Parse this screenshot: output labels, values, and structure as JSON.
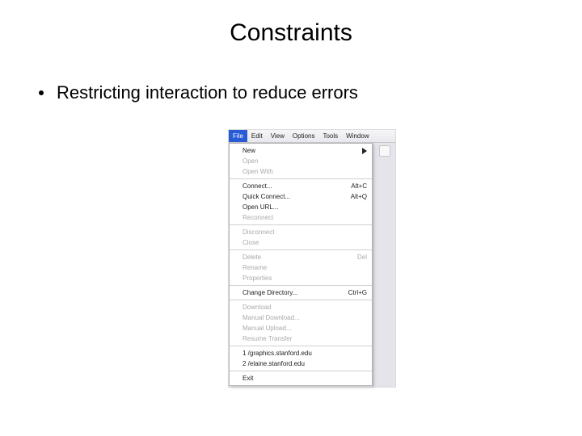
{
  "title": "Constraints",
  "bullet": "Restricting interaction to reduce errors",
  "menubar": {
    "items": [
      {
        "label": "File",
        "active": true
      },
      {
        "label": "Edit"
      },
      {
        "label": "View"
      },
      {
        "label": "Options"
      },
      {
        "label": "Tools"
      },
      {
        "label": "Window"
      }
    ]
  },
  "menu": {
    "groups": [
      [
        {
          "label": "New",
          "enabled": true,
          "submenu": true
        },
        {
          "label": "Open",
          "enabled": false
        },
        {
          "label": "Open With",
          "enabled": false
        }
      ],
      [
        {
          "label": "Connect...",
          "enabled": true,
          "shortcut": "Alt+C"
        },
        {
          "label": "Quick Connect...",
          "enabled": true,
          "shortcut": "Alt+Q"
        },
        {
          "label": "Open URL...",
          "enabled": true
        },
        {
          "label": "Reconnect",
          "enabled": false
        }
      ],
      [
        {
          "label": "Disconnect",
          "enabled": false
        },
        {
          "label": "Close",
          "enabled": false
        }
      ],
      [
        {
          "label": "Delete",
          "enabled": false,
          "shortcut": "Del"
        },
        {
          "label": "Rename",
          "enabled": false
        },
        {
          "label": "Properties",
          "enabled": false
        }
      ],
      [
        {
          "label": "Change Directory...",
          "enabled": true,
          "shortcut": "Ctrl+G"
        }
      ],
      [
        {
          "label": "Download",
          "enabled": false
        },
        {
          "label": "Manual Download...",
          "enabled": false
        },
        {
          "label": "Manual Upload...",
          "enabled": false
        },
        {
          "label": "Resume Transfer",
          "enabled": false
        }
      ],
      [
        {
          "label": "1 /graphics.stanford.edu",
          "enabled": true
        },
        {
          "label": "2 /elaine.stanford.edu",
          "enabled": true
        }
      ],
      [
        {
          "label": "Exit",
          "enabled": true
        }
      ]
    ]
  }
}
